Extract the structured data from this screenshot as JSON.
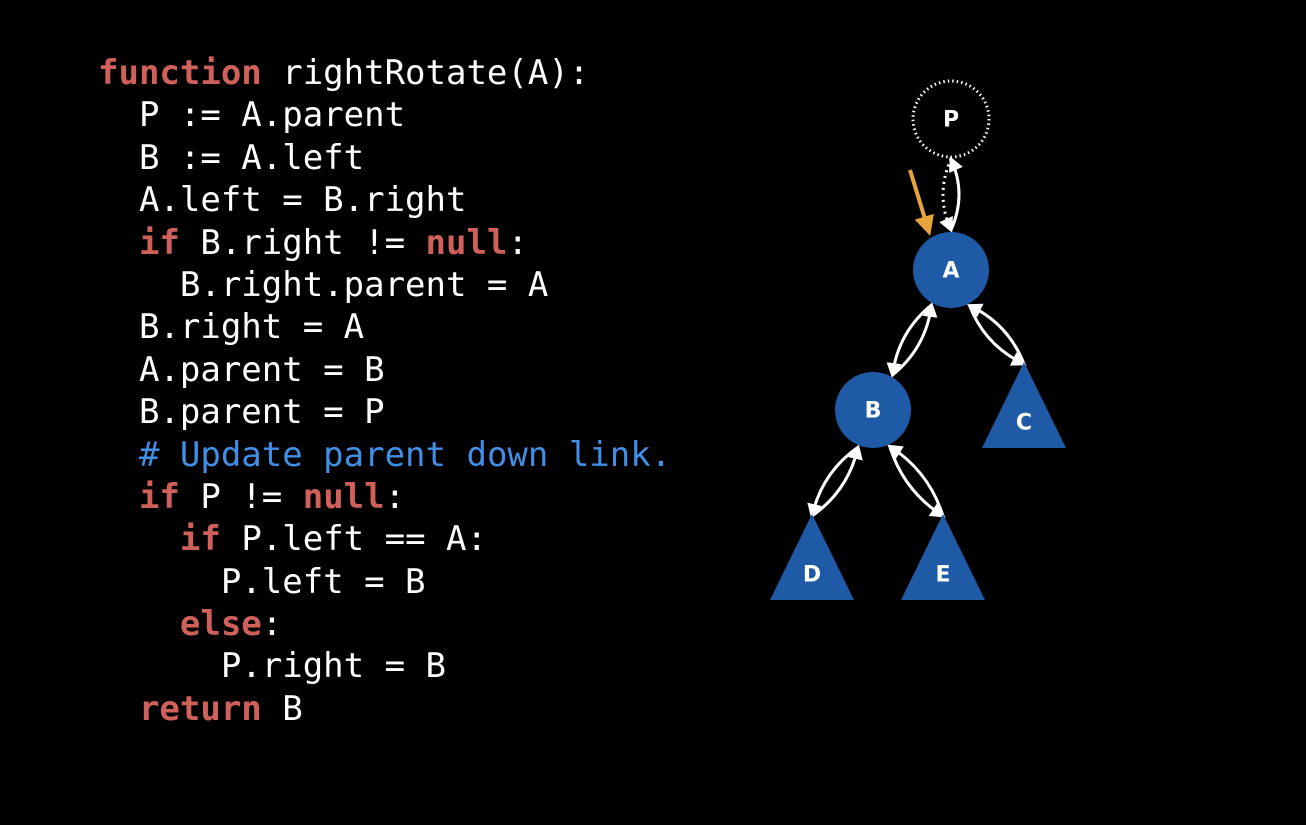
{
  "colors": {
    "background": "#000000",
    "keyword": "#d0605a",
    "comment": "#3f8fe6",
    "text": "#ffffff",
    "node_fill": "#1f5aa6",
    "highlight_arrow": "#e8a43a"
  },
  "code": {
    "lines": [
      {
        "indent": 0,
        "tokens": [
          {
            "t": "function",
            "c": "kw"
          },
          {
            "t": " rightRotate(A):",
            "c": "plain"
          }
        ]
      },
      {
        "indent": 1,
        "tokens": [
          {
            "t": "P := A.parent",
            "c": "plain"
          }
        ]
      },
      {
        "indent": 1,
        "tokens": [
          {
            "t": "B := A.left",
            "c": "plain"
          }
        ]
      },
      {
        "indent": 1,
        "tokens": [
          {
            "t": "A.left = B.right",
            "c": "plain"
          }
        ]
      },
      {
        "indent": 1,
        "tokens": [
          {
            "t": "if",
            "c": "kw"
          },
          {
            "t": " B.right != ",
            "c": "plain"
          },
          {
            "t": "null",
            "c": "kw"
          },
          {
            "t": ":",
            "c": "plain"
          }
        ]
      },
      {
        "indent": 2,
        "tokens": [
          {
            "t": "B.right.parent = A",
            "c": "plain"
          }
        ]
      },
      {
        "indent": 1,
        "tokens": [
          {
            "t": "B.right = A",
            "c": "plain"
          }
        ]
      },
      {
        "indent": 1,
        "tokens": [
          {
            "t": "A.parent = B",
            "c": "plain"
          }
        ]
      },
      {
        "indent": 1,
        "tokens": [
          {
            "t": "B.parent = P",
            "c": "plain"
          }
        ]
      },
      {
        "indent": 1,
        "tokens": [
          {
            "t": "# Update parent down link.",
            "c": "comment"
          }
        ]
      },
      {
        "indent": 1,
        "tokens": [
          {
            "t": "if",
            "c": "kw"
          },
          {
            "t": " P != ",
            "c": "plain"
          },
          {
            "t": "null",
            "c": "kw"
          },
          {
            "t": ":",
            "c": "plain"
          }
        ]
      },
      {
        "indent": 2,
        "tokens": [
          {
            "t": "if",
            "c": "kw"
          },
          {
            "t": " P.left == A:",
            "c": "plain"
          }
        ]
      },
      {
        "indent": 3,
        "tokens": [
          {
            "t": "P.left = B",
            "c": "plain"
          }
        ]
      },
      {
        "indent": 2,
        "tokens": [
          {
            "t": "else",
            "c": "kw"
          },
          {
            "t": ":",
            "c": "plain"
          }
        ]
      },
      {
        "indent": 3,
        "tokens": [
          {
            "t": "P.right = B",
            "c": "plain"
          }
        ]
      },
      {
        "indent": 1,
        "tokens": [
          {
            "t": "return",
            "c": "kw"
          },
          {
            "t": " B",
            "c": "plain"
          }
        ]
      }
    ]
  },
  "tree": {
    "nodes": [
      {
        "id": "P",
        "label": "P",
        "kind": "dotted-circle"
      },
      {
        "id": "A",
        "label": "A",
        "kind": "circle"
      },
      {
        "id": "B",
        "label": "B",
        "kind": "circle"
      },
      {
        "id": "C",
        "label": "C",
        "kind": "triangle"
      },
      {
        "id": "D",
        "label": "D",
        "kind": "triangle"
      },
      {
        "id": "E",
        "label": "E",
        "kind": "triangle"
      }
    ],
    "links": [
      {
        "from": "A",
        "to": "P",
        "style": "solid"
      },
      {
        "from": "P",
        "to": "A",
        "style": "dotted"
      },
      {
        "from": "A",
        "to": "B",
        "style": "solid"
      },
      {
        "from": "B",
        "to": "A",
        "style": "solid"
      },
      {
        "from": "A",
        "to": "C",
        "style": "solid"
      },
      {
        "from": "C",
        "to": "A",
        "style": "solid"
      },
      {
        "from": "B",
        "to": "D",
        "style": "solid"
      },
      {
        "from": "D",
        "to": "B",
        "style": "solid"
      },
      {
        "from": "B",
        "to": "E",
        "style": "solid"
      },
      {
        "from": "E",
        "to": "B",
        "style": "solid"
      }
    ],
    "pointer": {
      "target": "A",
      "color": "#e8a43a"
    }
  }
}
